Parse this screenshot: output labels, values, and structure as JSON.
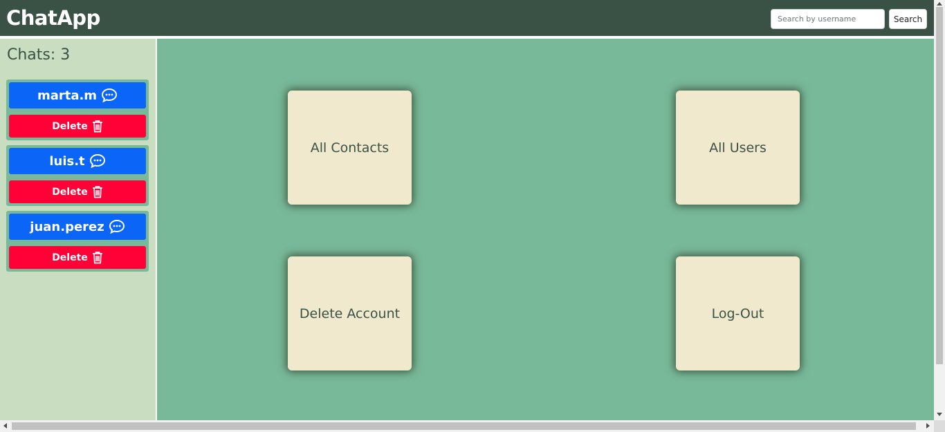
{
  "header": {
    "brand": "ChatApp",
    "search_placeholder": "Search by username",
    "search_value": "",
    "search_button": "Search"
  },
  "sidebar": {
    "chat_count_label": "Chats: 3",
    "chats": [
      {
        "username": "marta.m",
        "icon": "chat-bubble-icon",
        "delete_label": "Delete",
        "delete_icon": "trash-icon"
      },
      {
        "username": "luis.t",
        "icon": "chat-bubble-icon",
        "delete_label": "Delete",
        "delete_icon": "trash-icon"
      },
      {
        "username": "juan.perez",
        "icon": "chat-bubble-icon",
        "delete_label": "Delete",
        "delete_icon": "trash-icon"
      }
    ]
  },
  "main": {
    "tiles": [
      {
        "label": "All Contacts"
      },
      {
        "label": "All Users"
      },
      {
        "label": "Delete Account"
      },
      {
        "label": "Log-Out"
      }
    ]
  },
  "colors": {
    "navbar": "#3a5246",
    "sidebar": "#c9ddc0",
    "main": "#78b999",
    "chat_button": "#0b66f8",
    "delete_button": "#ff0137",
    "tile": "#f0e9cd"
  }
}
